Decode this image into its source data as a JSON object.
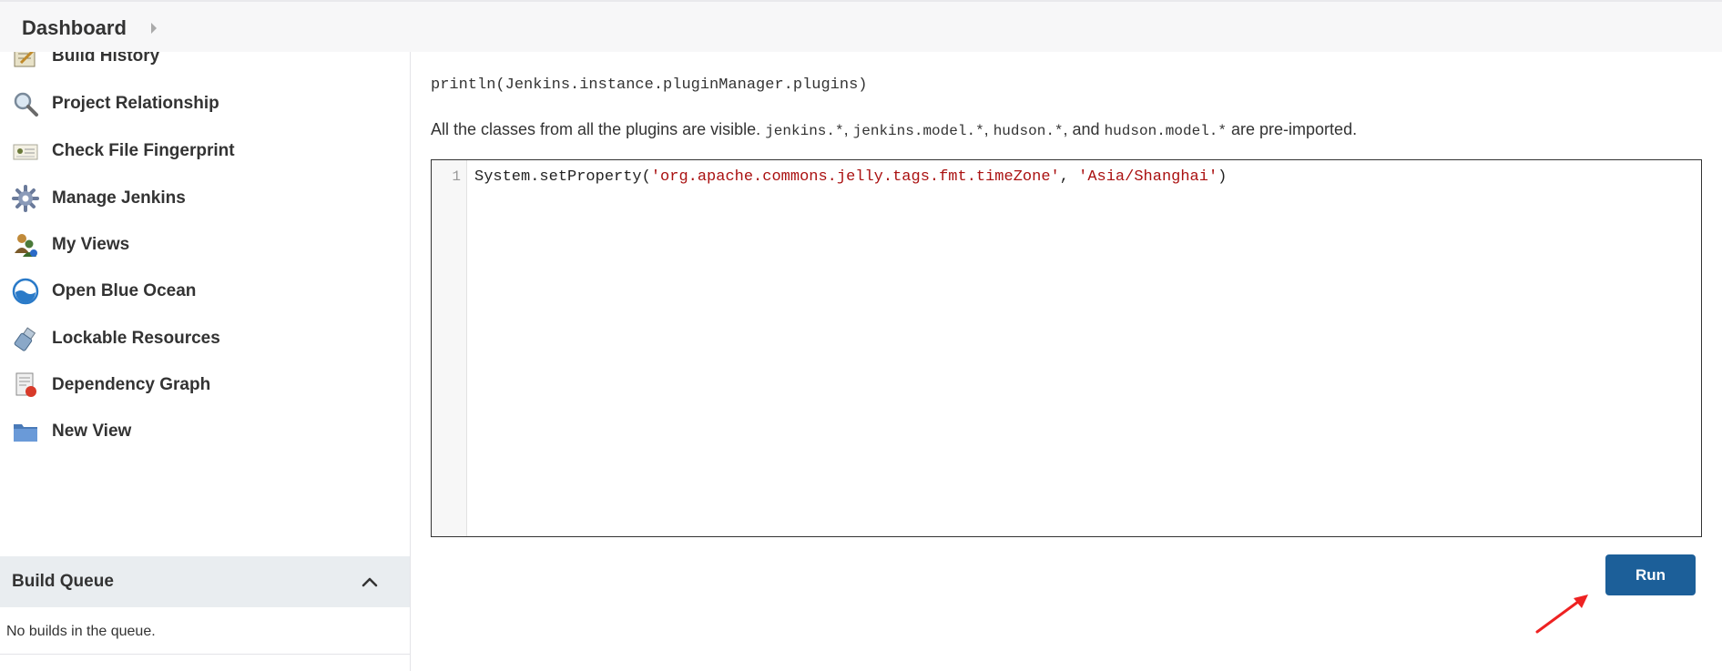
{
  "breadcrumb": {
    "item": "Dashboard"
  },
  "sidebar": {
    "items": [
      {
        "label": "Build History",
        "icon": "notepad-icon"
      },
      {
        "label": "Project Relationship",
        "icon": "magnifier-icon"
      },
      {
        "label": "Check File Fingerprint",
        "icon": "fingerprint-icon"
      },
      {
        "label": "Manage Jenkins",
        "icon": "gear-icon"
      },
      {
        "label": "My Views",
        "icon": "users-icon"
      },
      {
        "label": "Open Blue Ocean",
        "icon": "blue-ocean-icon"
      },
      {
        "label": "Lockable Resources",
        "icon": "usb-icon"
      },
      {
        "label": "Dependency Graph",
        "icon": "graph-icon"
      },
      {
        "label": "New View",
        "icon": "folder-icon"
      }
    ]
  },
  "build_queue": {
    "title": "Build Queue",
    "empty_text": "No builds in the queue."
  },
  "main": {
    "example": "println(Jenkins.instance.pluginManager.plugins)",
    "note": {
      "t1": "All the classes from all the plugins are visible.",
      "c1": "jenkins.*",
      "t2": ",",
      "c2": "jenkins.model.*",
      "t3": ",",
      "c3": "hudson.*",
      "t4": ", and",
      "c4": "hudson.model.*",
      "t5": "are pre-imported."
    },
    "editor": {
      "line_number": "1",
      "code_prefix": "System.setProperty(",
      "string1": "'org.apache.commons.jelly.tags.fmt.timeZone'",
      "separator": ", ",
      "string2": "'Asia/Shanghai'",
      "code_suffix": ")"
    },
    "run_label": "Run"
  },
  "colors": {
    "accent": "#1c5f99",
    "string": "#aa1111",
    "annotation_arrow": "#ee2222"
  }
}
